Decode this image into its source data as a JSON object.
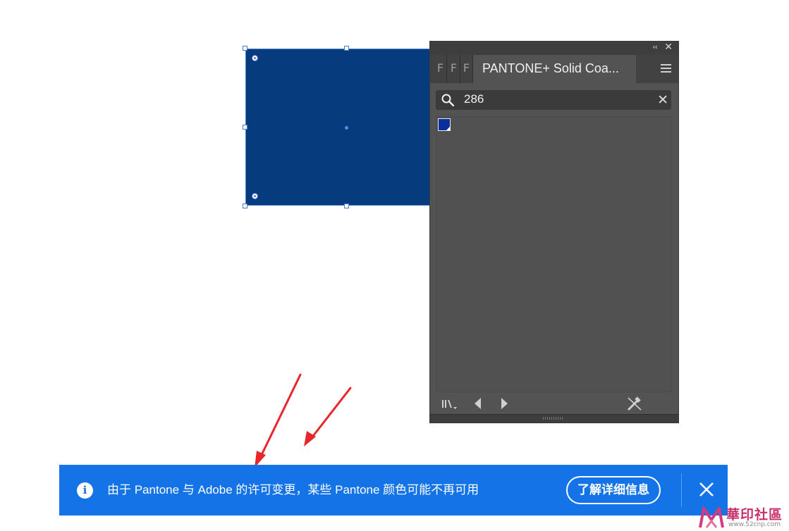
{
  "canvas": {
    "rect_fill": "#063b7d",
    "selection_color": "#4a7cc7"
  },
  "panel": {
    "mini_tabs": [
      "F",
      "F",
      "F"
    ],
    "active_tab": "PANTONE+ Solid Coa...",
    "search": {
      "value": "286"
    },
    "swatches": [
      {
        "color": "#0b2f99"
      }
    ],
    "colors": {
      "background": "#535353",
      "tabstrip": "#424242"
    }
  },
  "arrows": {
    "color": "#e8262b"
  },
  "notification": {
    "message": "由于 Pantone 与 Adobe 的许可变更，某些 Pantone 颜色可能不再可用",
    "button_label": "了解详细信息",
    "background": "#1473e6"
  },
  "watermark": {
    "text": "華印社區",
    "url": "www.52cnp.com"
  }
}
